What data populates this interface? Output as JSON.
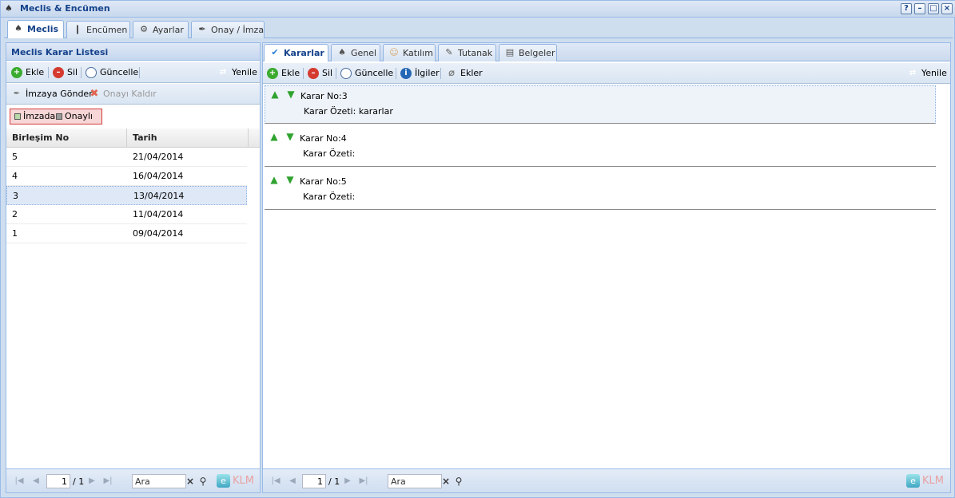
{
  "window": {
    "title": "Meclis & Encümen"
  },
  "top_tabs": [
    {
      "label": "Meclis",
      "icon": "people-icon",
      "active": true
    },
    {
      "label": "Encümen",
      "icon": "person-icon",
      "active": false
    },
    {
      "label": "Ayarlar",
      "icon": "settings-icon",
      "active": false
    },
    {
      "label": "Onay / İmza",
      "icon": "signature-icon",
      "active": false
    }
  ],
  "left_panel": {
    "title": "Meclis Karar Listesi",
    "toolbar": {
      "add": "Ekle",
      "delete": "Sil",
      "update": "Güncelle",
      "refresh": "Yenile"
    },
    "toolbar2": {
      "send_sign": "İmzaya Gönder",
      "remove_approval": "Onayı Kaldır"
    },
    "filters": {
      "in_signing": "İmzada",
      "approved": "Onaylı"
    },
    "grid": {
      "columns": [
        "Birleşim No",
        "Tarih"
      ],
      "rows": [
        {
          "no": "5",
          "date": "21/04/2014"
        },
        {
          "no": "4",
          "date": "16/04/2014"
        },
        {
          "no": "3",
          "date": "13/04/2014",
          "selected": true
        },
        {
          "no": "2",
          "date": "11/04/2014"
        },
        {
          "no": "1",
          "date": "09/04/2014"
        }
      ]
    },
    "paging": {
      "page": "1",
      "of": "/ 1",
      "search_placeholder": "Ara",
      "brand": "KLM"
    }
  },
  "right_panel": {
    "tabs": [
      {
        "label": "Kararlar",
        "icon": "check-icon",
        "active": true
      },
      {
        "label": "Genel",
        "icon": "people-icon",
        "active": false
      },
      {
        "label": "Katılım",
        "icon": "person-icon",
        "active": false
      },
      {
        "label": "Tutanak",
        "icon": "edit-icon",
        "active": false
      },
      {
        "label": "Belgeler",
        "icon": "documents-icon",
        "active": false
      }
    ],
    "toolbar": {
      "add": "Ekle",
      "delete": "Sil",
      "update": "Güncelle",
      "related": "İlgiler",
      "attachments": "Ekler",
      "refresh": "Yenile"
    },
    "decisions": [
      {
        "no": "Karar No:3",
        "summary": "Karar Özeti: kararlar",
        "selected": true
      },
      {
        "no": "Karar No:4",
        "summary": "Karar Özeti:"
      },
      {
        "no": "Karar No:5",
        "summary": "Karar Özeti:"
      }
    ],
    "paging": {
      "page": "1",
      "of": "/ 1",
      "search_placeholder": "Ara",
      "brand": "KLM"
    }
  },
  "colors": {
    "accent": "#15428b",
    "frame": "#99bbe8",
    "selection": "#dfe8f6",
    "filter_border": "#d43c3c"
  }
}
